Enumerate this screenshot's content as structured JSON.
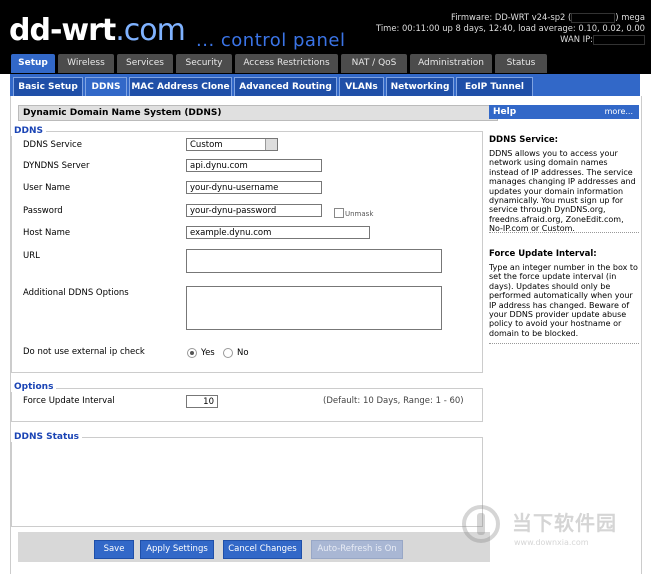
{
  "header": {
    "logo_text": "dd-wrt",
    "logo_suffix": ".com",
    "subtitle": "... control panel",
    "firmware_label": "Firmware: DD-WRT v24-sp2 (",
    "firmware_tail": ") mega",
    "time_line": "Time: 00:11:00 up 8 days, 12:40, load average: 0.10, 0.02, 0.00",
    "wan_ip": "WAN IP:"
  },
  "main_tabs": [
    "Setup",
    "Wireless",
    "Services",
    "Security",
    "Access Restrictions",
    "NAT / QoS",
    "Administration",
    "Status"
  ],
  "sub_tabs": [
    "Basic Setup",
    "DDNS",
    "MAC Address Clone",
    "Advanced Routing",
    "VLANs",
    "Networking",
    "EoIP Tunnel"
  ],
  "page_title": "Dynamic Domain Name System (DDNS)",
  "ddns": {
    "legend": "DDNS",
    "service_label": "DDNS Service",
    "service_value": "Custom",
    "server_label": "DYNDNS Server",
    "server_value": "api.dynu.com",
    "user_label": "User Name",
    "user_value": "your-dynu-username",
    "password_label": "Password",
    "password_value": "your-dynu-password",
    "unmask_label": "Unmask",
    "host_label": "Host Name",
    "host_value": "example.dynu.com",
    "url_label": "URL",
    "url_value": "",
    "options_label": "Additional DDNS Options",
    "options_value": "",
    "external_ip_label": "Do not use external ip check",
    "yes_label": "Yes",
    "no_label": "No"
  },
  "options": {
    "legend": "Options",
    "force_label": "Force Update Interval",
    "force_value": "10",
    "force_hint": "(Default: 10 Days, Range: 1 - 60)"
  },
  "status": {
    "legend": "DDNS Status"
  },
  "buttons": {
    "save": "Save",
    "apply": "Apply Settings",
    "cancel": "Cancel Changes",
    "autorefresh": "Auto-Refresh is On"
  },
  "help": {
    "title": "Help",
    "more": "more...",
    "h1": "DDNS Service:",
    "p1": "DDNS allows you to access your network using domain names instead of IP addresses. The service manages changing IP addresses and updates your domain information dynamically. You must sign up for service through DynDNS.org, freedns.afraid.org, ZoneEdit.com, No-IP.com or Custom.",
    "h2": "Force Update Interval:",
    "p2": "Type an integer number in the box to set the force update interval (in days). Updates should only be performed automatically when your IP address has changed. Beware of your DDNS provider update abuse policy to avoid your hostname or domain to be blocked."
  },
  "watermark": {
    "text": "当下软件园",
    "url": "www.downxia.com"
  },
  "colors": {
    "accent": "#3268c8",
    "legend": "#1a44b5"
  }
}
